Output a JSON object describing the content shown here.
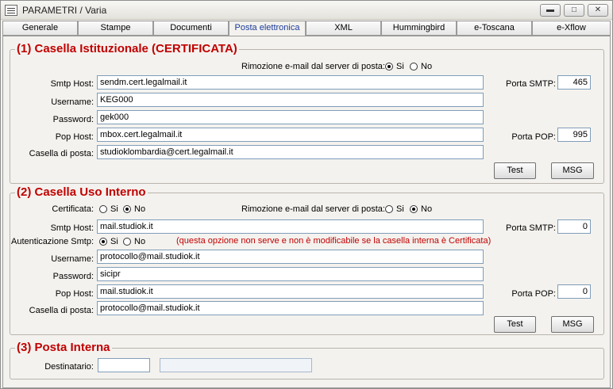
{
  "window": {
    "title": "PARAMETRI / Varia"
  },
  "tabs": [
    {
      "label": "Generale"
    },
    {
      "label": "Stampe"
    },
    {
      "label": "Documenti"
    },
    {
      "label": "Posta elettronica"
    },
    {
      "label": "XML"
    },
    {
      "label": "Hummingbird"
    },
    {
      "label": "e-Toscana"
    },
    {
      "label": "e-Xflow"
    }
  ],
  "section1": {
    "title": "(1) Casella Istituzionale (CERTIFICATA)",
    "rimozione_label": "Rimozione e-mail dal server di posta:",
    "yes_label": "Si",
    "no_label": "No",
    "rimozione_value": "Si",
    "smtp_host_label": "Smtp Host:",
    "smtp_host": "sendm.cert.legalmail.it",
    "username_label": "Username:",
    "username": "KEG000",
    "password_label": "Password:",
    "password": "gek000",
    "pop_host_label": "Pop Host:",
    "pop_host": "mbox.cert.legalmail.it",
    "casella_label": "Casella di posta:",
    "casella": "studioklombardia@cert.legalmail.it",
    "porta_smtp_label": "Porta SMTP:",
    "porta_smtp": "465",
    "porta_pop_label": "Porta POP:",
    "porta_pop": "995",
    "test_label": "Test",
    "msg_label": "MSG"
  },
  "section2": {
    "title": "(2) Casella Uso Interno",
    "certificata_label": "Certificata:",
    "certificata_value": "No",
    "rimozione_label": "Rimozione e-mail dal server di posta:",
    "rimozione_value": "No",
    "yes_label": "Si",
    "no_label": "No",
    "smtp_host_label": "Smtp Host:",
    "smtp_host": "mail.studiok.it",
    "autenticazione_label": "Autenticazione Smtp:",
    "autenticazione_value": "Si",
    "note": "(questa opzione non serve e non è modificabile se la casella interna è Certificata)",
    "username_label": "Username:",
    "username": "protocollo@mail.studiok.it",
    "password_label": "Password:",
    "password": "sicipr",
    "pop_host_label": "Pop Host:",
    "pop_host": "mail.studiok.it",
    "casella_label": "Casella di posta:",
    "casella": "protocollo@mail.studiok.it",
    "porta_smtp_label": "Porta SMTP:",
    "porta_smtp": "0",
    "porta_pop_label": "Porta POP:",
    "porta_pop": "0",
    "test_label": "Test",
    "msg_label": "MSG"
  },
  "section3": {
    "title": "(3) Posta Interna",
    "destinatario_label": "Destinatario:",
    "destinatario": "",
    "destinatario_desc": ""
  },
  "icons": {
    "app": "form-icon",
    "minimize": "minimize-icon",
    "maximize": "maximize-icon",
    "close": "close-icon"
  }
}
